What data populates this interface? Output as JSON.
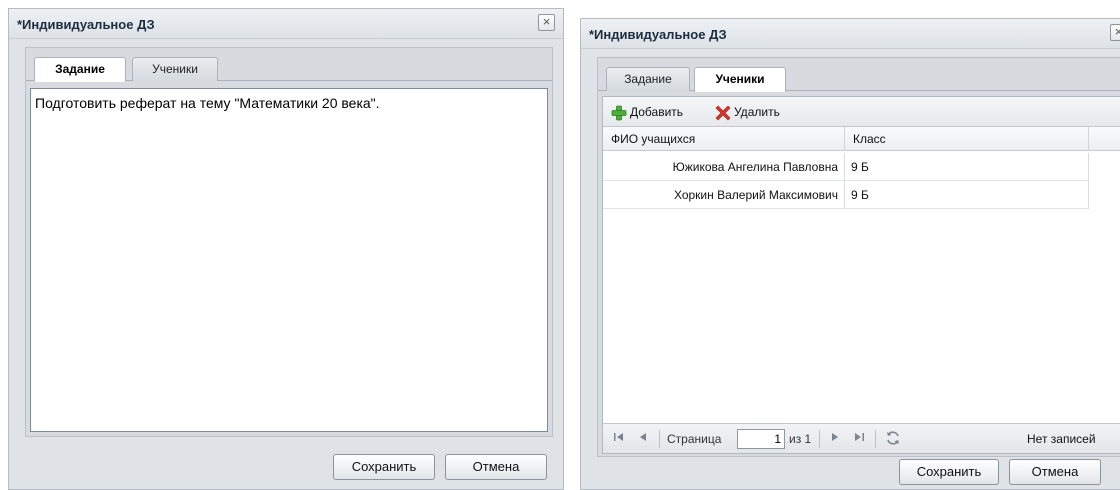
{
  "left_dialog": {
    "title": "*Индивидуальное ДЗ",
    "close_icon": "×",
    "tabs": [
      {
        "label": "Задание",
        "active": true
      },
      {
        "label": "Ученики",
        "active": false
      }
    ],
    "task_text": "Подготовить реферат на тему \"Математики 20 века\".",
    "save_label": "Сохранить",
    "cancel_label": "Отмена"
  },
  "right_dialog": {
    "title": "*Индивидуальное ДЗ",
    "close_icon": "×",
    "tabs": [
      {
        "label": "Задание",
        "active": false
      },
      {
        "label": "Ученики",
        "active": true
      }
    ],
    "toolbar": {
      "add_label": "Добавить",
      "delete_label": "Удалить"
    },
    "grid": {
      "columns": [
        "ФИО учащихся",
        "Класс"
      ],
      "rows": [
        [
          "Южикова Ангелина Павловна",
          "9 Б"
        ],
        [
          "Хоркин Валерий Максимович",
          "9 Б"
        ]
      ]
    },
    "pager": {
      "page_label": "Страница",
      "page_value": "1",
      "of_label": "из 1",
      "status": "Нет записей"
    },
    "save_label": "Сохранить",
    "cancel_label": "Отмена"
  },
  "colors": {
    "add_icon": "#4caf3a",
    "delete_icon": "#d9342b",
    "window_bg": "#dfe3e8"
  },
  "icons": [
    "close-icon",
    "add-icon",
    "delete-icon",
    "first-page-icon",
    "prev-page-icon",
    "next-page-icon",
    "last-page-icon",
    "refresh-icon"
  ]
}
